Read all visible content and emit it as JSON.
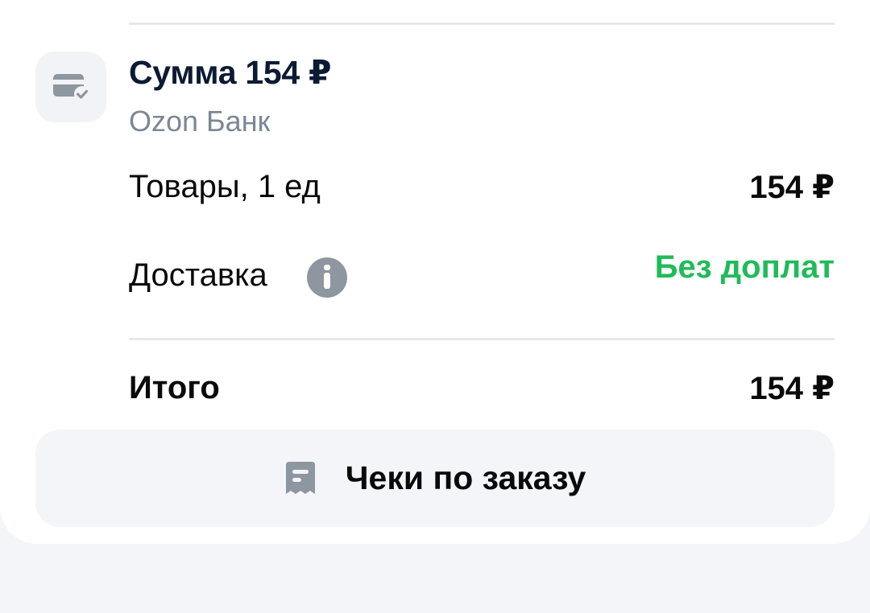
{
  "payment": {
    "icon": "card-check-icon",
    "title": "Сумма 154 ₽",
    "method": "Ozon Банк"
  },
  "summary": {
    "goods_label": "Товары, 1 ед",
    "goods_value": "154 ₽",
    "delivery_label": "Доставка",
    "delivery_value": "Без доплат",
    "delivery_info_icon": "info-icon",
    "total_label": "Итого",
    "total_value": "154 ₽"
  },
  "receipts_button": {
    "icon": "receipt-icon",
    "label": "Чеки по заказу"
  },
  "colors": {
    "accent_green": "#1fbb58",
    "muted_text": "#7b8794",
    "icon_gray": "#8e969f",
    "page_background": "#f4f5f9"
  }
}
